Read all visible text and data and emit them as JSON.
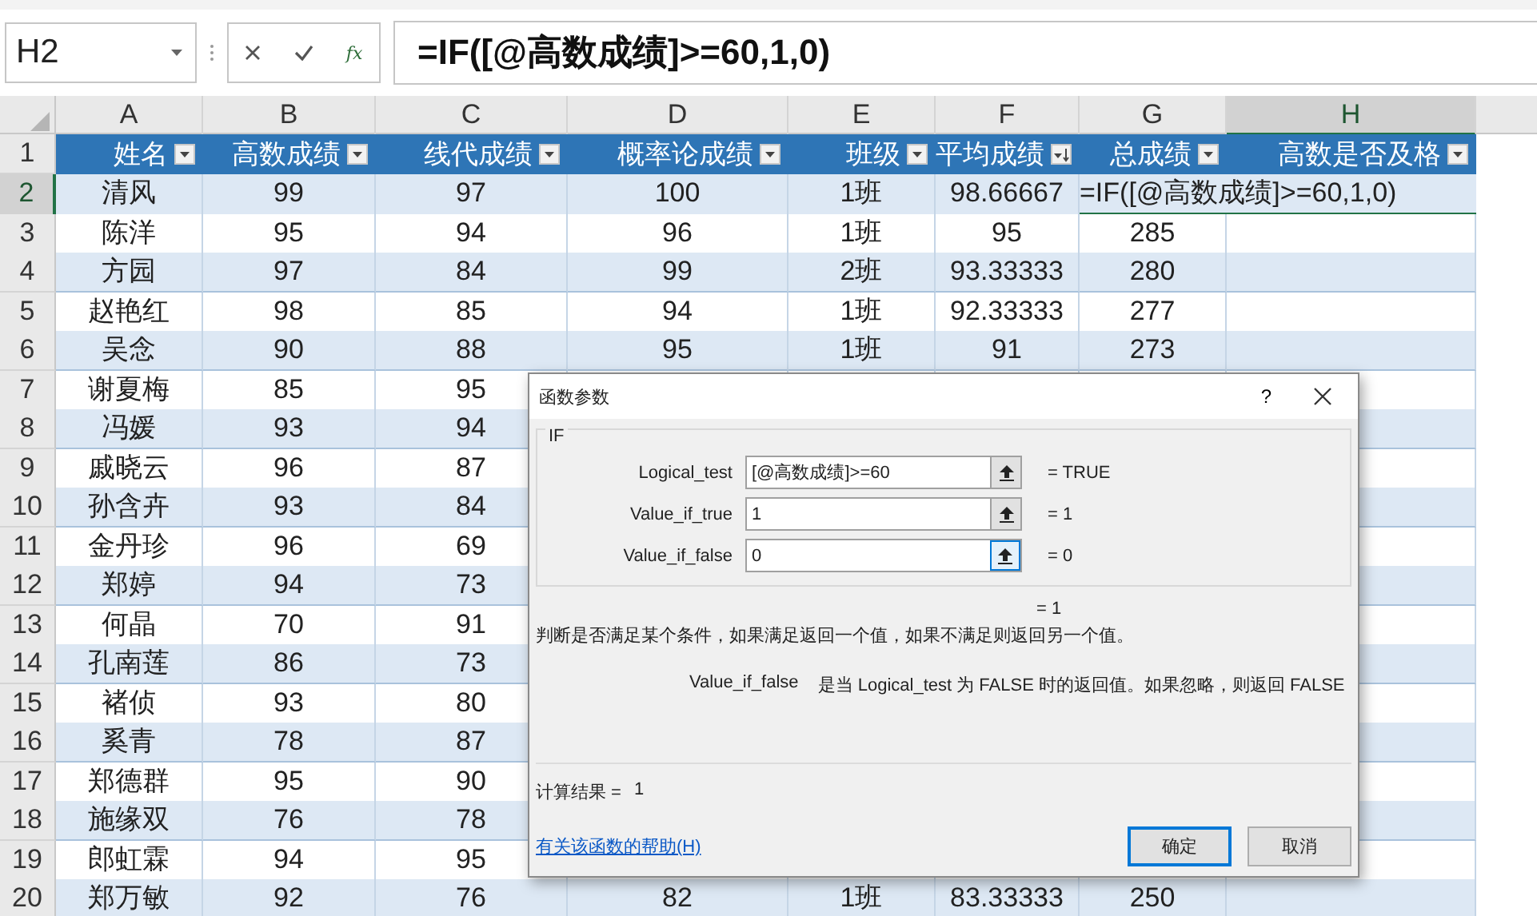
{
  "formula_bar": {
    "name_box": "H2",
    "insert_function": "fx",
    "formula": "=IF([@高数成绩]>=60,1,0)"
  },
  "sheet": {
    "columns": [
      {
        "label": "A",
        "selected": false
      },
      {
        "label": "B",
        "selected": false
      },
      {
        "label": "C",
        "selected": false
      },
      {
        "label": "D",
        "selected": false
      },
      {
        "label": "E",
        "selected": false
      },
      {
        "label": "F",
        "selected": false
      },
      {
        "label": "G",
        "selected": false
      },
      {
        "label": "H",
        "selected": true
      }
    ],
    "header_row": {
      "number": "1",
      "cells": [
        {
          "text": "姓名",
          "kind": "dropdown"
        },
        {
          "text": "高数成绩",
          "kind": "dropdown"
        },
        {
          "text": "线代成绩",
          "kind": "dropdown"
        },
        {
          "text": "概率论成绩",
          "kind": "dropdown"
        },
        {
          "text": "班级",
          "kind": "dropdown"
        },
        {
          "text": "平均成绩",
          "kind": "sorted"
        },
        {
          "text": "总成绩",
          "kind": "dropdown"
        },
        {
          "text": "高数是否及格",
          "kind": "dropdown"
        }
      ]
    },
    "rows": [
      {
        "number": "2",
        "selected": true,
        "cells": [
          "清风",
          "99",
          "97",
          "100",
          "1班",
          "98.66667"
        ],
        "editor": "=IF([@高数成绩]>=60,1,0)"
      },
      {
        "number": "3",
        "selected": false,
        "cells": [
          "陈洋",
          "95",
          "94",
          "96",
          "1班",
          "95",
          "285"
        ]
      },
      {
        "number": "4",
        "selected": false,
        "cells": [
          "方园",
          "97",
          "84",
          "99",
          "2班",
          "93.33333",
          "280"
        ]
      },
      {
        "number": "5",
        "selected": false,
        "cells": [
          "赵艳红",
          "98",
          "85",
          "94",
          "1班",
          "92.33333",
          "277"
        ]
      },
      {
        "number": "6",
        "selected": false,
        "cells": [
          "吴念",
          "90",
          "88",
          "95",
          "1班",
          "91",
          "273"
        ]
      },
      {
        "number": "7",
        "selected": false,
        "cells": [
          "谢夏梅",
          "85",
          "95"
        ]
      },
      {
        "number": "8",
        "selected": false,
        "cells": [
          "冯媛",
          "93",
          "94"
        ]
      },
      {
        "number": "9",
        "selected": false,
        "cells": [
          "戚晓云",
          "96",
          "87"
        ]
      },
      {
        "number": "10",
        "selected": false,
        "cells": [
          "孙含卉",
          "93",
          "84"
        ]
      },
      {
        "number": "11",
        "selected": false,
        "cells": [
          "金丹珍",
          "96",
          "69"
        ]
      },
      {
        "number": "12",
        "selected": false,
        "cells": [
          "郑婷",
          "94",
          "73"
        ]
      },
      {
        "number": "13",
        "selected": false,
        "cells": [
          "何晶",
          "70",
          "91"
        ]
      },
      {
        "number": "14",
        "selected": false,
        "cells": [
          "孔南莲",
          "86",
          "73"
        ]
      },
      {
        "number": "15",
        "selected": false,
        "cells": [
          "褚侦",
          "93",
          "80"
        ]
      },
      {
        "number": "16",
        "selected": false,
        "cells": [
          "奚青",
          "78",
          "87"
        ]
      },
      {
        "number": "17",
        "selected": false,
        "cells": [
          "郑德群",
          "95",
          "90"
        ]
      },
      {
        "number": "18",
        "selected": false,
        "cells": [
          "施缘双",
          "76",
          "78"
        ]
      },
      {
        "number": "19",
        "selected": false,
        "cells": [
          "郎虹霖",
          "94",
          "95"
        ]
      },
      {
        "number": "20",
        "selected": false,
        "cells": [
          "郑万敏",
          "92",
          "76",
          "82",
          "1班",
          "83.33333",
          "250"
        ]
      }
    ]
  },
  "dialog": {
    "title": "函数参数",
    "help": "?",
    "function": "IF",
    "arguments": [
      {
        "label": "Logical_test",
        "value": "[@高数成绩]>=60",
        "result": "= TRUE",
        "focused": false
      },
      {
        "label": "Value_if_true",
        "value": "1",
        "result": "= 1",
        "focused": false
      },
      {
        "label": "Value_if_false",
        "value": "0",
        "result": "= 0",
        "focused": true
      }
    ],
    "formula_result": "= 1",
    "description": "判断是否满足某个条件，如果满足返回一个值，如果不满足则返回另一个值。",
    "argument_help": {
      "name": "Value_if_false",
      "text": "是当 Logical_test 为 FALSE 时的返回值。如果忽略，则返回 FALSE"
    },
    "calc_label": "计算结果 =",
    "calc_value": "1",
    "help_link": "有关该函数的帮助(H)",
    "buttons": [
      {
        "label": "确定",
        "default": true
      },
      {
        "label": "取消",
        "default": false
      }
    ]
  }
}
